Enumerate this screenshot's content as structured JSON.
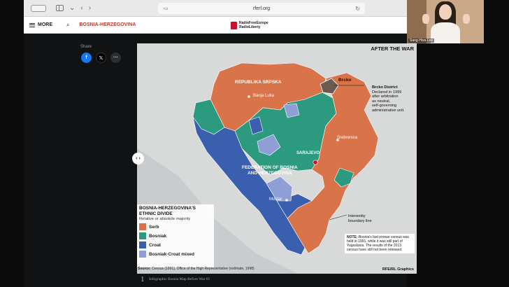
{
  "browser": {
    "url": "rferl.org"
  },
  "site": {
    "menu_label": "MORE",
    "section": "BOSNIA-HERZEGOVINA",
    "logo_line1": "RadioFreeEurope",
    "logo_line2": "RadioLiberty"
  },
  "share": {
    "label": "Share",
    "facebook": "f",
    "x": "𝕏",
    "more": "···"
  },
  "graphic": {
    "title": "AFTER THE WAR",
    "regions": {
      "republika_srpska": "REPUBLIKA SRPSKA",
      "federation_line1": "FEDERATION OF BOSNIA",
      "federation_line2": "AND HERZEGOVINA"
    },
    "cities": {
      "banja_luka": "Banja Luka",
      "sarajevo": "SARAJEVO",
      "srebrenica": "Srebrenica",
      "mostar": "Mostar"
    },
    "brcko_label": "Brcko",
    "brcko_note": [
      "Brcko District",
      "Declared in 1999",
      "after arbitration",
      "as neutral,",
      "self-governing",
      "administrative unit."
    ],
    "boundary_note": [
      "Interentity",
      "boundary line"
    ],
    "legend": {
      "title_line1": "BOSNIA-HERZEGOVINA'S",
      "title_line2": "ETHNIC DIVIDE",
      "subtitle": "Relative or absolute majority",
      "items": [
        {
          "label": "Serb",
          "color": "#d9744a"
        },
        {
          "label": "Bosniak",
          "color": "#2b9a7e"
        },
        {
          "label": "Croat",
          "color": "#3a5fae"
        },
        {
          "label": "Bosniak-Croat mixed",
          "color": "#8f9fd6"
        }
      ]
    },
    "note": {
      "bold": "NOTE:",
      "text": "Bosnia's last prewar census was held in 1991, while it was still part of Yugoslavia. The results of the 2013 census have still not been released."
    },
    "source_bold": "Source:",
    "source": "Census (1991), Office of the High Representative (estimate, 1998)",
    "credit": "RFE/RL Graphics"
  },
  "caption": {
    "number": "1",
    "text": "Infographic Bosnia Map Before War 01"
  },
  "video": {
    "name": "Sang-Hwa Lee"
  },
  "colors": {
    "serb": "#d9744a",
    "bosniak": "#2b9a7e",
    "croat": "#3a5fae",
    "mixed": "#8f9fd6",
    "brcko": "#6a5a52"
  }
}
